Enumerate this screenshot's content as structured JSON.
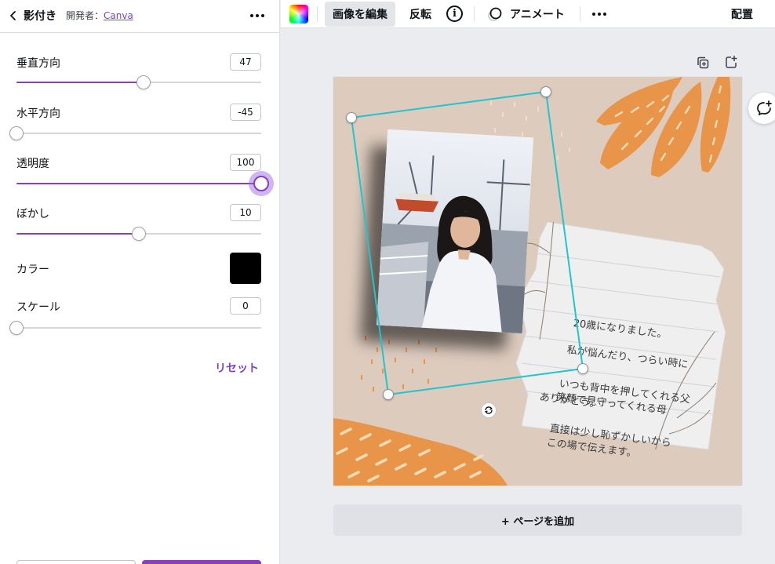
{
  "panel": {
    "title": "影付き",
    "developer_prefix": "開発者：",
    "developer_link": "Canva",
    "settings": {
      "vertical": {
        "label": "垂直方向",
        "value": "47",
        "fraction": 0.52
      },
      "horizontal": {
        "label": "水平方向",
        "value": "-45",
        "fraction": 0.0
      },
      "opacity": {
        "label": "透明度",
        "value": "100",
        "fraction": 1.0
      },
      "blur": {
        "label": "ぼかし",
        "value": "10",
        "fraction": 0.5
      },
      "color": {
        "label": "カラー",
        "value": "#000000"
      },
      "scale": {
        "label": "スケール",
        "value": "0",
        "fraction": 0.0
      }
    },
    "reset_label": "リセット"
  },
  "toolbar": {
    "edit_image": "画像を編集",
    "flip": "反転",
    "info": "i",
    "animate": "アニメート",
    "arrange": "配置"
  },
  "canvas": {
    "add_page": "+ ページを追加",
    "note_lines": [
      "20歳になりました。",
      "私が悩んだり、つらい時に",
      "いつも背中を押してくれる父",
      "笑顔で見守ってくれる母",
      "直接は少し恥ずかしいから",
      "この場で伝えます。",
      "ありがとう。"
    ]
  },
  "colors": {
    "accent": "#8b3dbb",
    "link": "#7b3fd6",
    "selection": "#1fc5cf",
    "page_bg": "#ddcbbe",
    "orange": "#e89449"
  },
  "icons": {
    "back": "chevron-left-icon",
    "more": "more-horizontal-icon",
    "duplicate_page": "duplicate-icon",
    "add_page": "add-page-icon",
    "comment": "comment-add-icon",
    "rotate": "rotate-icon",
    "animate": "animate-icon"
  }
}
